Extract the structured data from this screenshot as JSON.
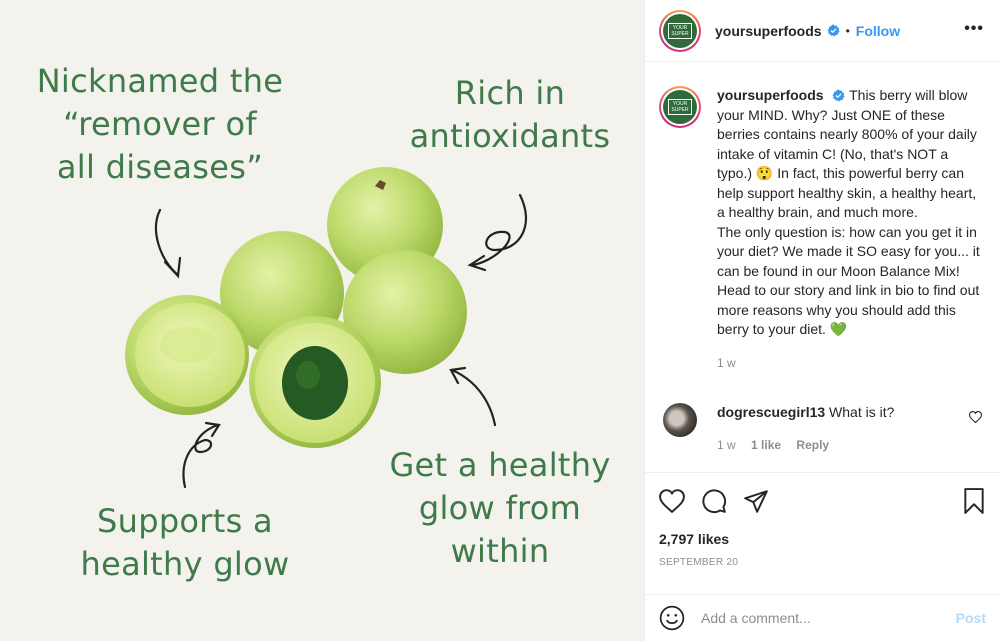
{
  "image": {
    "label_1": "Nicknamed the\n“remover of\nall diseases”",
    "label_2": "Rich in\nantioxidants",
    "label_3": "Supports a\nhealthy glow",
    "label_4": "Get a healthy\nglow from\nwithin",
    "text_color": "#3e7a4a",
    "background": "#f3f2ed"
  },
  "header": {
    "username": "yoursuperfoods",
    "separator": "•",
    "follow_label": "Follow",
    "more_label": "•••",
    "avatar_text": "YOUR\nSUPER"
  },
  "caption": {
    "username": "yoursuperfoods",
    "text": "This berry will blow your MIND. Why? Just ONE of these berries contains nearly 800% of your daily intake of vitamin C! (No, that's NOT a typo.) 😲 In fact, this powerful berry can help support healthy skin, a healthy heart, a healthy brain, and much more.\nThe only question is: how can you get it in your diet? We made it SO easy for you... it can be found in our Moon Balance Mix! Head to our story and link in bio to find out more reasons why you should add this berry to your diet. 💚",
    "time": "1 w"
  },
  "comment": {
    "username": "dogrescuegirl13",
    "text": "What is it?",
    "time": "1 w",
    "likes": "1 like",
    "reply_label": "Reply"
  },
  "post": {
    "likes": "2,797 likes",
    "date": "SEPTEMBER 20"
  },
  "add_comment": {
    "placeholder": "Add a comment...",
    "post_label": "Post"
  },
  "colors": {
    "accent": "#3897f0",
    "post_disabled": "#b3dbff",
    "brand_green": "#2f6b3a"
  },
  "icons": [
    "verified-badge-icon",
    "more-options-icon",
    "heart-icon",
    "comment-icon",
    "share-icon",
    "bookmark-icon",
    "emoji-icon"
  ]
}
